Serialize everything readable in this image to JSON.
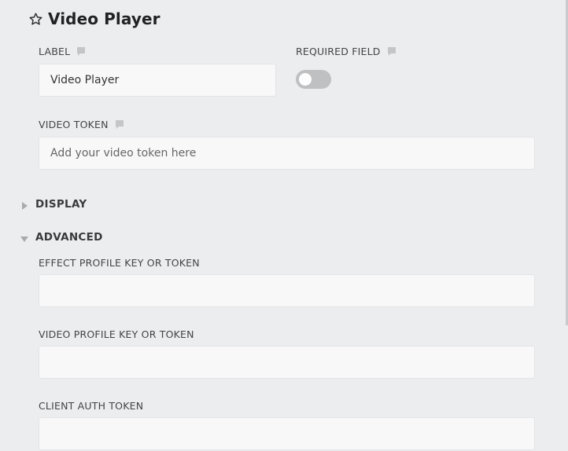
{
  "header": {
    "title": "Video Player",
    "star_icon": "star-outline-icon"
  },
  "fields": {
    "label": {
      "label": "LABEL",
      "value": "Video Player",
      "comment_icon": "comment-icon"
    },
    "required": {
      "label": "REQUIRED FIELD",
      "enabled": false,
      "comment_icon": "comment-icon"
    },
    "video_token": {
      "label": "VIDEO TOKEN",
      "placeholder": "Add your video token here",
      "value": "",
      "comment_icon": "comment-icon"
    }
  },
  "sections": {
    "display": {
      "label": "DISPLAY",
      "expanded": false
    },
    "advanced": {
      "label": "ADVANCED",
      "expanded": true,
      "fields": {
        "effect_profile": {
          "label": "EFFECT PROFILE KEY OR TOKEN",
          "value": ""
        },
        "video_profile": {
          "label": "VIDEO PROFILE KEY OR TOKEN",
          "value": ""
        },
        "client_auth": {
          "label": "CLIENT AUTH TOKEN",
          "value": ""
        }
      }
    }
  },
  "colors": {
    "background": "#ecedef",
    "input_background": "#f8f8f9",
    "toggle_off": "#bfc0c2"
  }
}
